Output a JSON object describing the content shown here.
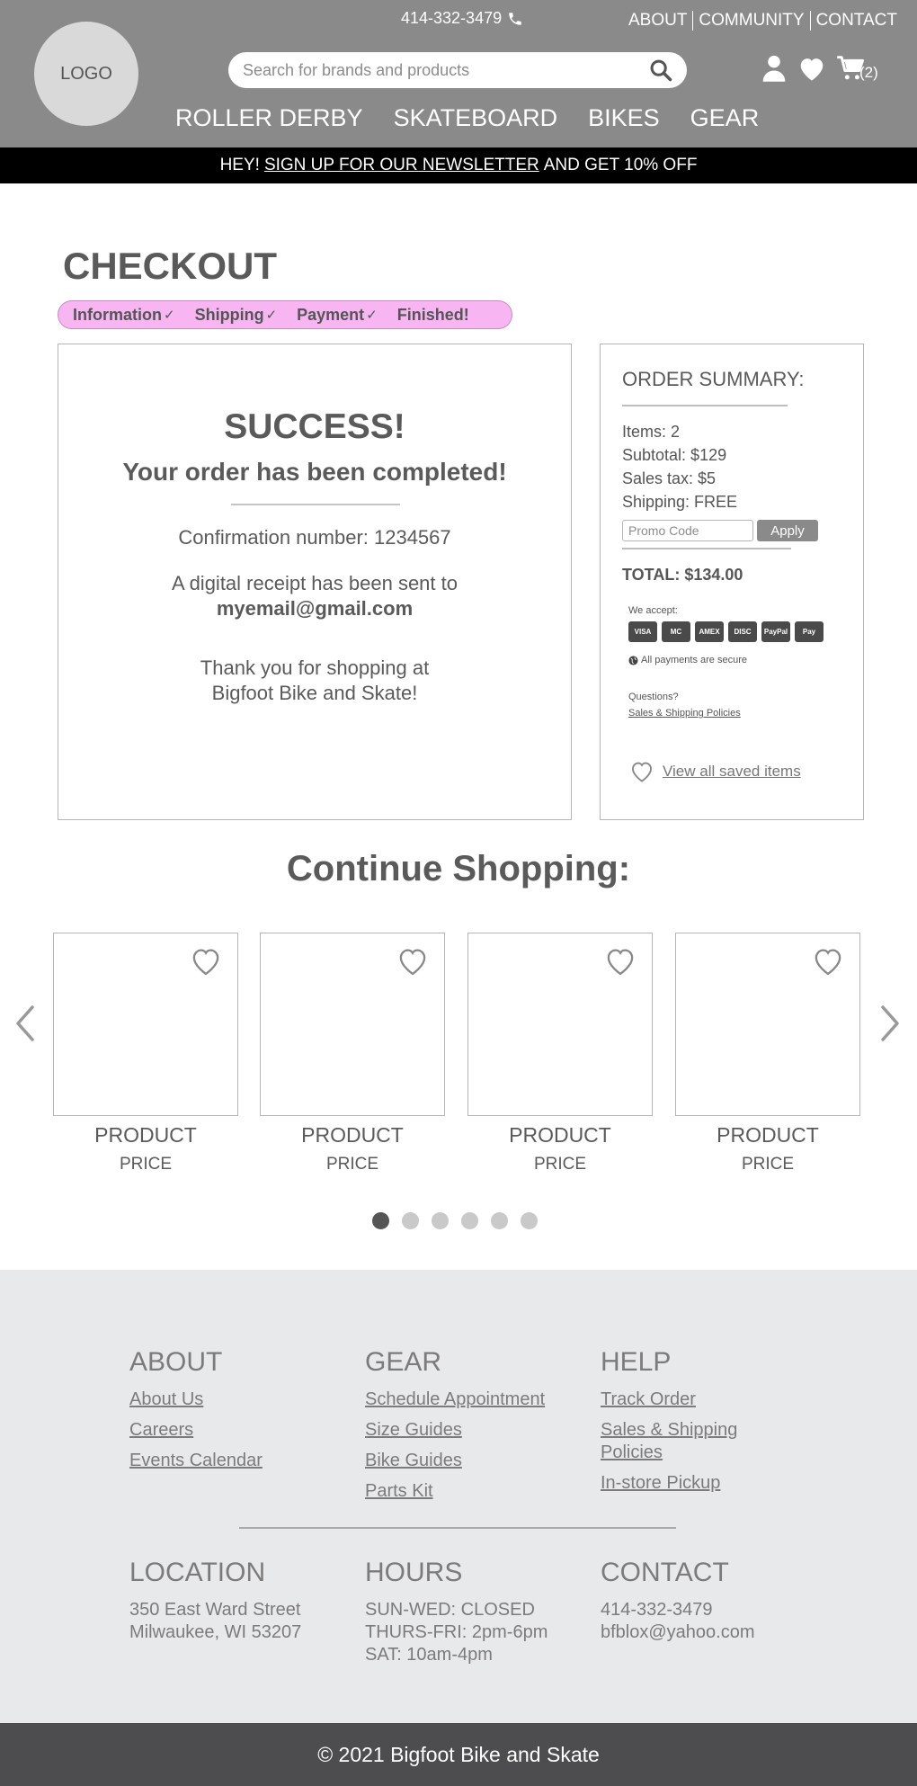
{
  "header": {
    "logo_text": "LOGO",
    "phone": "414-332-3479",
    "top_links": [
      "ABOUT",
      "COMMUNITY",
      "CONTACT"
    ],
    "search_placeholder": "Search for brands and products",
    "cart_count": "(2)",
    "nav": [
      "ROLLER DERBY",
      "SKATEBOARD",
      "BIKES",
      "GEAR"
    ]
  },
  "promo_bar": {
    "prefix": "HEY!",
    "link": "SIGN UP FOR OUR NEWSLETTER",
    "suffix": "AND GET 10% OFF"
  },
  "checkout": {
    "title": "CHECKOUT",
    "steps": [
      {
        "label": "Information",
        "check": "✓"
      },
      {
        "label": "Shipping",
        "check": "✓"
      },
      {
        "label": "Payment",
        "check": "✓"
      },
      {
        "label": "Finished!",
        "check": ""
      }
    ],
    "success": {
      "title": "SUCCESS!",
      "subtitle": "Your order has been completed!",
      "confirmation": "Confirmation number: 1234567",
      "receipt_text": "A digital receipt has been sent to",
      "email": "myemail@gmail.com",
      "thanks_line1": "Thank you for shopping at",
      "thanks_line2": "Bigfoot Bike and Skate!"
    },
    "summary": {
      "title": "ORDER SUMMARY:",
      "items": "Items: 2",
      "subtotal": "Subtotal: $129",
      "tax": "Sales tax: $5",
      "shipping": "Shipping: FREE",
      "promo_placeholder": "Promo Code",
      "apply_label": "Apply",
      "total": "TOTAL: $134.00",
      "we_accept": "We accept:",
      "cards": [
        "VISA",
        "MC",
        "AMEX",
        "DISC",
        "PayPal",
        "Pay"
      ],
      "secure": "All payments are secure",
      "questions": "Questions?",
      "policies_link": "Sales & Shipping Policies",
      "saved_link": "View all saved items"
    }
  },
  "continue_shopping": {
    "title": "Continue Shopping:",
    "products": [
      {
        "name": "PRODUCT",
        "price": "PRICE"
      },
      {
        "name": "PRODUCT",
        "price": "PRICE"
      },
      {
        "name": "PRODUCT",
        "price": "PRICE"
      },
      {
        "name": "PRODUCT",
        "price": "PRICE"
      }
    ],
    "page_count": 6,
    "active_page": 1
  },
  "footer": {
    "about": {
      "heading": "ABOUT",
      "links": [
        "About Us",
        "Careers",
        "Events Calendar"
      ]
    },
    "gear": {
      "heading": "GEAR",
      "links": [
        "Schedule Appointment",
        "Size Guides",
        "Bike Guides",
        "Parts Kit"
      ]
    },
    "help": {
      "heading": "HELP",
      "links": [
        "Track Order",
        "Sales & Shipping Policies",
        "In-store Pickup"
      ]
    },
    "location": {
      "heading": "LOCATION",
      "line1": "350 East Ward Street",
      "line2": "Milwaukee, WI 53207"
    },
    "hours": {
      "heading": "HOURS",
      "line1": "SUN-WED: CLOSED",
      "line2": "THURS-FRI: 2pm-6pm",
      "line3": "SAT: 10am-4pm"
    },
    "contact": {
      "heading": "CONTACT",
      "phone": "414-332-3479",
      "email": "bfblox@yahoo.com"
    },
    "copyright": "© 2021 Bigfoot Bike and Skate"
  }
}
